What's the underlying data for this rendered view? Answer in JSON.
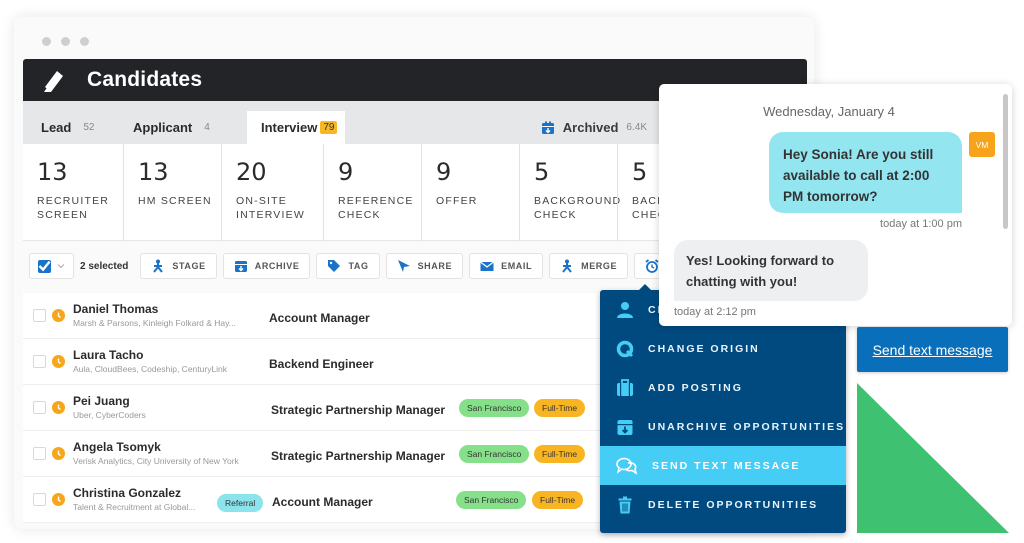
{
  "window": {
    "title": "Candidates"
  },
  "tabs": [
    {
      "label": "Lead",
      "count": "52"
    },
    {
      "label": "Applicant",
      "count": "4"
    },
    {
      "label": "Interview",
      "count": "79"
    },
    {
      "label": "Archived",
      "count": "6.4K"
    }
  ],
  "stages": [
    {
      "count": "13",
      "label": "RECRUITER SCREEN"
    },
    {
      "count": "13",
      "label": "HM SCREEN"
    },
    {
      "count": "20",
      "label": "ON-SITE INTERVIEW"
    },
    {
      "count": "9",
      "label": "REFERENCE CHECK"
    },
    {
      "count": "9",
      "label": "OFFER"
    },
    {
      "count": "5",
      "label": "BACKGROUND CHECK"
    },
    {
      "count": "5",
      "label": "BACKGROUND CHECK"
    }
  ],
  "toolbar": {
    "selected_label": "2 selected",
    "buttons": [
      "STAGE",
      "ARCHIVE",
      "TAG",
      "SHARE",
      "EMAIL",
      "MERGE",
      "SNOOZE"
    ]
  },
  "candidates": [
    {
      "name": "Daniel Thomas",
      "desc": "Marsh & Parsons, Kinleigh Folkard & Hay...",
      "title": "Account Manager"
    },
    {
      "name": "Laura Tacho",
      "desc": "Aula, CloudBees, Codeship, CenturyLink",
      "title": "Backend Engineer"
    },
    {
      "name": "Pei Juang",
      "desc": "Uber, CyberCoders",
      "title": "Strategic Partnership Manager",
      "location": "San Francisco",
      "type": "Full-Time"
    },
    {
      "name": "Angela Tsomyk",
      "desc": "Verisk Analytics, City University of New York",
      "title": "Strategic Partnership Manager",
      "location": "San Francisco",
      "type": "Full-Time"
    },
    {
      "name": "Christina Gonzalez",
      "desc": "Talent & Recruitment at Global...",
      "tag": "Referral",
      "title": "Account Manager",
      "location": "San Francisco",
      "type": "Full-Time"
    }
  ],
  "dropdown": {
    "items": [
      {
        "label": "CHANGE OWNER",
        "icon": "person-icon"
      },
      {
        "label": "CHANGE ORIGIN",
        "icon": "origin-icon"
      },
      {
        "label": "ADD POSTING",
        "icon": "briefcase-icon"
      },
      {
        "label": "UNARCHIVE OPPORTUNITIES",
        "icon": "unarchive-icon"
      },
      {
        "label": "SEND TEXT MESSAGE",
        "icon": "chat-bubbles-icon",
        "active": true
      },
      {
        "label": "DELETE OPPORTUNITIES",
        "icon": "trash-icon"
      }
    ]
  },
  "chat": {
    "date": "Wednesday, January 4",
    "outgoing": "Hey Sonia! Are you still available to call at 2:00 PM tomorrow?",
    "outgoing_time": "today at 1:00 pm",
    "avatar": "VM",
    "incoming": "Yes! Looking forward to chatting with you!",
    "incoming_time": "today at 2:12 pm",
    "send_button": "Send text message"
  },
  "colors": {
    "accent_blue": "#0a6fbb",
    "dropdown_bg": "#004a80",
    "active_item": "#46cdf5",
    "orange": "#f9b521",
    "green_pill": "#86e08a",
    "triangle": "#3ec170"
  }
}
